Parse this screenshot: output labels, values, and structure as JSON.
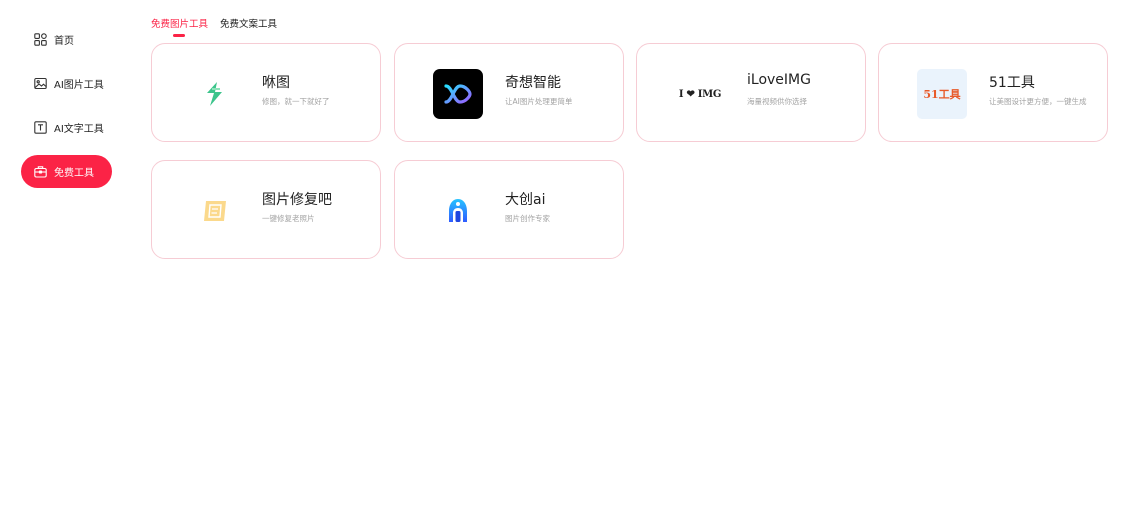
{
  "sidebar": {
    "items": [
      {
        "label": "首页",
        "icon": "grid-icon",
        "active": false
      },
      {
        "label": "AI图片工具",
        "icon": "image-icon",
        "active": false
      },
      {
        "label": "AI文字工具",
        "icon": "text-icon",
        "active": false
      },
      {
        "label": "免费工具",
        "icon": "toolbox-icon",
        "active": true
      }
    ]
  },
  "tabs": [
    {
      "label": "免费图片工具",
      "active": true
    },
    {
      "label": "免费文案工具",
      "active": false
    }
  ],
  "cards": [
    {
      "name": "咻图",
      "desc": "修图，就一下就好了",
      "icon": "xiutu-logo-icon",
      "color": "#3cc48b"
    },
    {
      "name": "奇想智能",
      "desc": "让AI图片处理更简单",
      "icon": "qixiang-logo-icon",
      "color": "#000000"
    },
    {
      "name": "iLoveIMG",
      "desc": "海量视频供你选择",
      "icon": "iloveimg-logo-icon",
      "logo_text": "I ❤ IMG",
      "color": "#e94c4c"
    },
    {
      "name": "51工具",
      "desc": "让美图设计更方便，一键生成",
      "icon": "51tools-logo-icon",
      "logo_text": "51工具",
      "color": "#e85a2a"
    },
    {
      "name": "图片修复吧",
      "desc": "一键修复老照片",
      "icon": "image-repair-logo-icon",
      "color": "#f7c96b"
    },
    {
      "name": "大创ai",
      "desc": "图片创作专家",
      "icon": "dachuang-logo-icon",
      "color": "#2f7bff"
    }
  ],
  "colors": {
    "accent": "#fb2346",
    "card_border": "#f6ccd4",
    "muted_text": "#a3a3a3"
  }
}
